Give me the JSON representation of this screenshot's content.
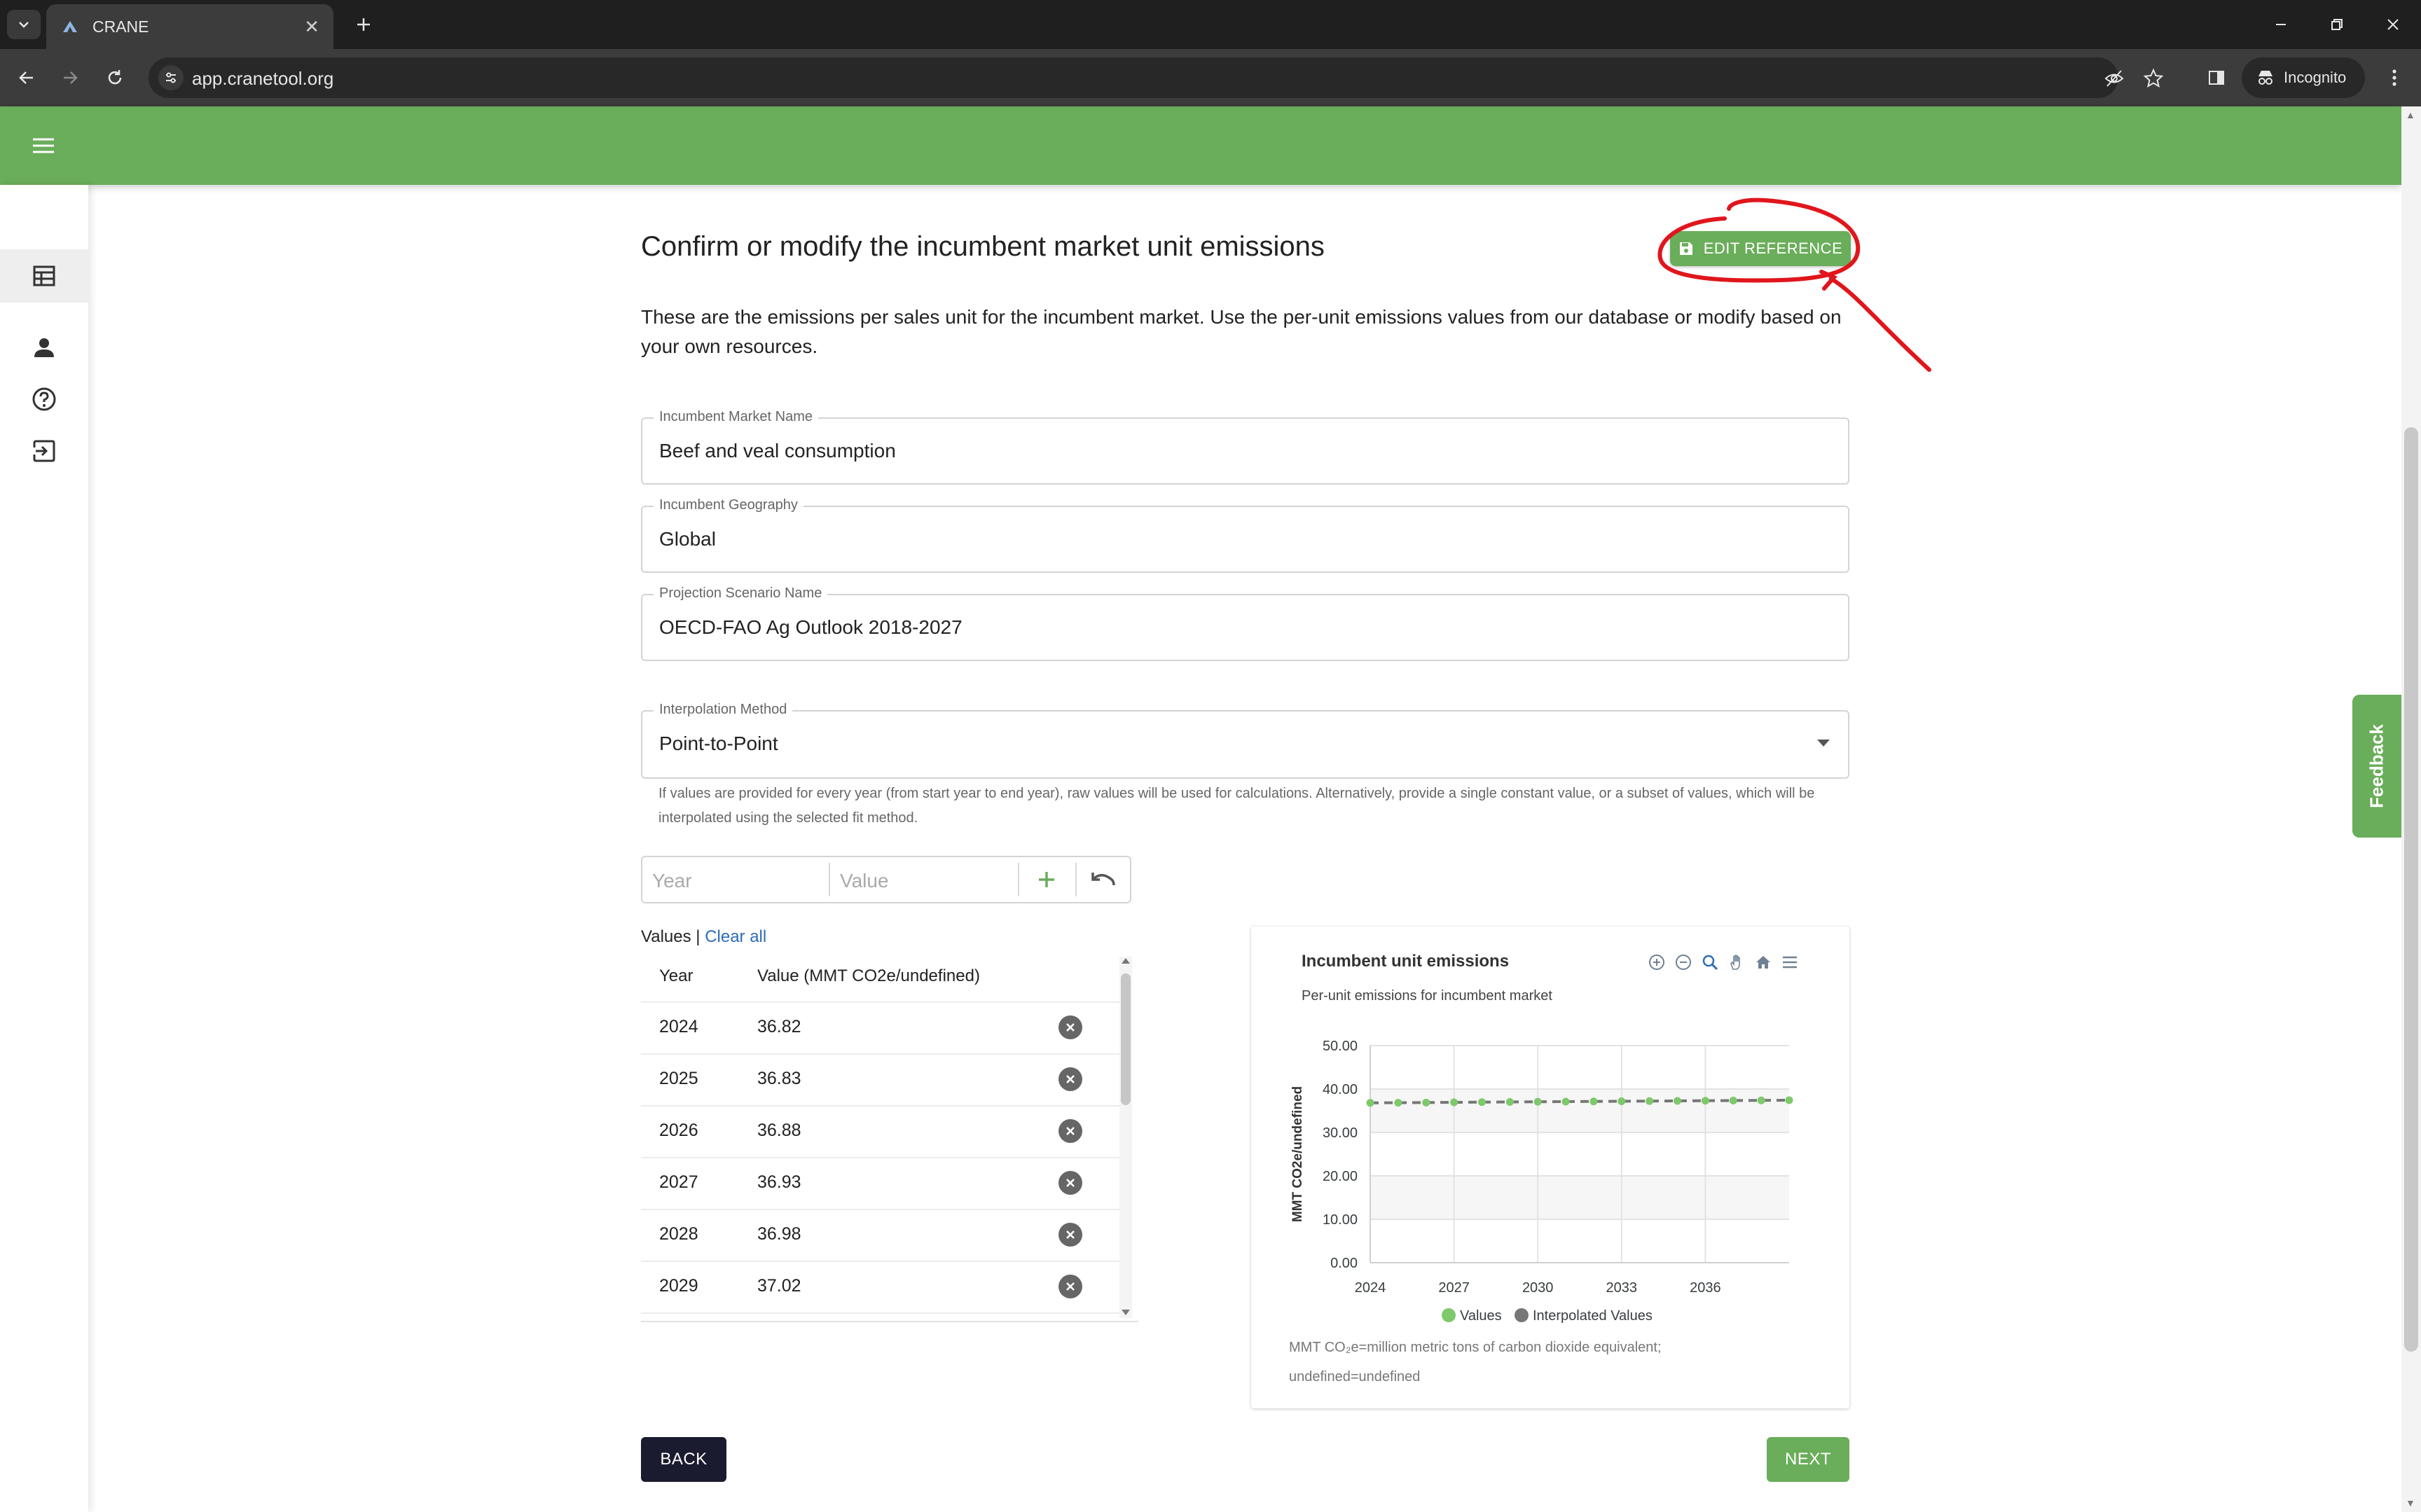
{
  "browser": {
    "tab_title": "CRANE",
    "url": "app.cranetool.org",
    "incognito_label": "Incognito"
  },
  "page": {
    "title": "Confirm or modify the incumbent market unit emissions",
    "edit_reference_label": "EDIT REFERENCE",
    "description": "These are the emissions per sales unit for the incumbent market. Use the per-unit emissions values from our database or modify based on your own resources."
  },
  "fields": {
    "market_name": {
      "label": "Incumbent Market Name",
      "value": "Beef and veal consumption"
    },
    "geography": {
      "label": "Incumbent Geography",
      "value": "Global"
    },
    "scenario": {
      "label": "Projection Scenario Name",
      "value": "OECD-FAO Ag Outlook 2018-2027"
    },
    "interpolation": {
      "label": "Interpolation Method",
      "value": "Point-to-Point"
    }
  },
  "helper_text": "If values are provided for every year (from start year to end year), raw values will be used for calculations. Alternatively, provide a single constant value, or a subset of values, which will be interpolated using the selected fit method.",
  "entry": {
    "year_placeholder": "Year",
    "value_placeholder": "Value"
  },
  "values_section": {
    "heading": "Values",
    "separator": " | ",
    "clear_all": "Clear all",
    "col_year": "Year",
    "col_value": "Value (MMT CO2e/undefined)",
    "rows": [
      {
        "year": "2024",
        "value": "36.82"
      },
      {
        "year": "2025",
        "value": "36.83"
      },
      {
        "year": "2026",
        "value": "36.88"
      },
      {
        "year": "2027",
        "value": "36.93"
      },
      {
        "year": "2028",
        "value": "36.98"
      },
      {
        "year": "2029",
        "value": "37.02"
      }
    ]
  },
  "chart_data": {
    "type": "line",
    "title": "Incumbent unit emissions",
    "subtitle": "Per-unit emissions for incumbent market",
    "ylabel": "MMT CO2e/undefined",
    "xlabel": "",
    "ylim": [
      0,
      50
    ],
    "xlim": [
      2024,
      2039
    ],
    "y_ticks": [
      "0.00",
      "10.00",
      "20.00",
      "30.00",
      "40.00",
      "50.00"
    ],
    "x_ticks": [
      "2024",
      "2027",
      "2030",
      "2033",
      "2036"
    ],
    "x": [
      2024,
      2025,
      2026,
      2027,
      2028,
      2029,
      2030,
      2031,
      2032,
      2033,
      2034,
      2035,
      2036,
      2037,
      2038,
      2039
    ],
    "series": [
      {
        "name": "Values",
        "color": "#7dc96b",
        "values": [
          36.82,
          36.83,
          36.88,
          36.93,
          36.98,
          37.02,
          37.06,
          37.1,
          37.14,
          37.18,
          37.22,
          37.26,
          37.3,
          37.34,
          37.38,
          37.42
        ]
      },
      {
        "name": "Interpolated Values",
        "color": "#777777",
        "values": [
          36.82,
          36.83,
          36.88,
          36.93,
          36.98,
          37.02,
          37.06,
          37.1,
          37.14,
          37.18,
          37.22,
          37.26,
          37.3,
          37.34,
          37.38,
          37.42
        ]
      }
    ],
    "grid": true,
    "legend": "bottom",
    "footnote_line1": "MMT CO₂e=million metric tons of carbon dioxide equivalent;",
    "footnote_line2": "undefined=undefined"
  },
  "buttons": {
    "back": "BACK",
    "next": "NEXT"
  },
  "feedback_label": "Feedback",
  "colors": {
    "brand_green": "#6aad5a",
    "link_blue": "#2f6cb8",
    "annotation_red": "#e0161c"
  }
}
